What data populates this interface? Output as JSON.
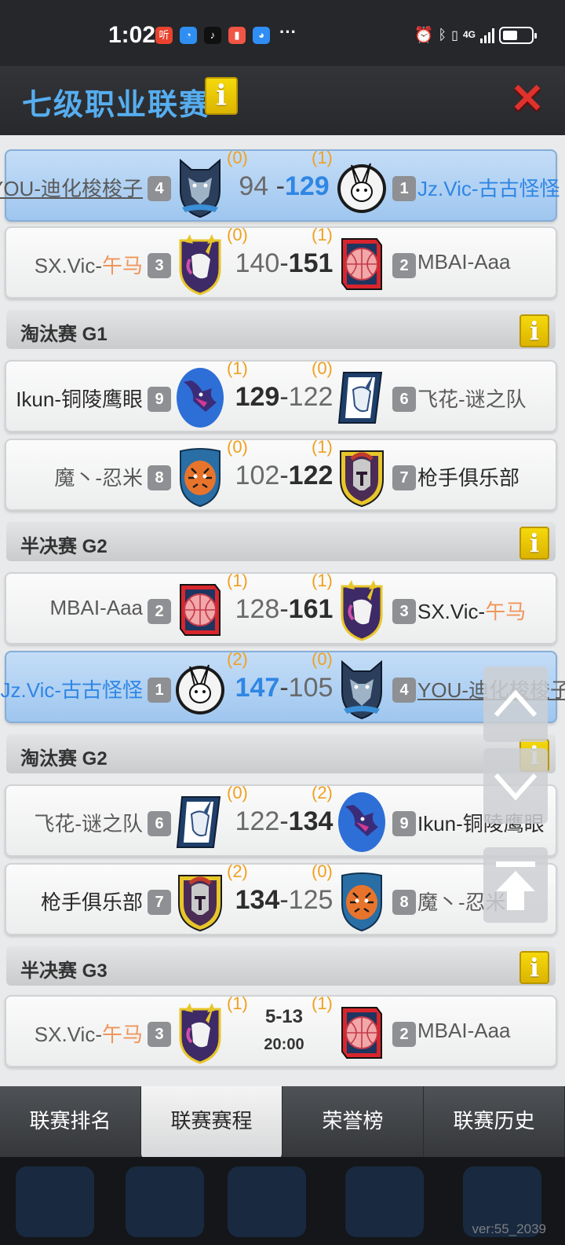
{
  "status_bar": {
    "time": "1:02",
    "network": "4G",
    "apps": [
      {
        "name": "listen-app-icon",
        "glyph": "听",
        "color": "#e8432f"
      },
      {
        "name": "chat-app-icon",
        "glyph": "◔",
        "color": "#2e8ef2"
      },
      {
        "name": "tiktok-icon",
        "glyph": "♪",
        "color": "#101010"
      },
      {
        "name": "red-app-icon",
        "glyph": "▮",
        "color": "#f05545"
      },
      {
        "name": "weibo-icon",
        "glyph": "◕",
        "color": "#2f8df4"
      }
    ],
    "more": "···"
  },
  "header": {
    "title": "七级职业联赛",
    "info_glyph": "i",
    "close_glyph": "✕"
  },
  "matches": [
    {
      "left": {
        "name": "YOU-迪化梭梭子",
        "seed": "4",
        "wins": "(0)",
        "logo": "wolf"
      },
      "right": {
        "name_a": "Jz.Vic-古古怪怪",
        "name_b": "",
        "seed": "1",
        "wins": "(1)",
        "logo": "rabbit"
      },
      "score_left": "94",
      "score_right": "129",
      "highlight": true,
      "winner": "right"
    },
    {
      "left": {
        "name_a": "SX.Vic-",
        "name_b": "午马",
        "seed": "3",
        "wins": "(0)",
        "logo": "unicorn"
      },
      "right": {
        "name_a": "MBAI-Aaa",
        "name_b": "",
        "seed": "2",
        "wins": "(1)",
        "logo": "basketball"
      },
      "score_left": "140",
      "score_right": "151",
      "highlight": false,
      "winner": "right"
    },
    {
      "left": {
        "name_a": "Ikun-铜陵鹰眼",
        "name_b": "",
        "seed": "9",
        "wins": "(1)",
        "logo": "dragon"
      },
      "right": {
        "name_a": "飞花-谜之队",
        "name_b": "",
        "seed": "6",
        "wins": "(0)",
        "logo": "unicorn-blue"
      },
      "score_left": "129",
      "score_right": "122",
      "highlight": false,
      "winner": "left"
    },
    {
      "left": {
        "name_a": "魔丶-忍米",
        "name_b": "",
        "seed": "8",
        "wins": "(0)",
        "logo": "tiger"
      },
      "right": {
        "name_a": "枪手俱乐部",
        "name_b": "",
        "seed": "7",
        "wins": "(1)",
        "logo": "spartan"
      },
      "score_left": "102",
      "score_right": "122",
      "highlight": false,
      "winner": "right"
    },
    {
      "left": {
        "name_a": "MBAI-Aaa",
        "name_b": "",
        "seed": "2",
        "wins": "(1)",
        "logo": "basketball"
      },
      "right": {
        "name_a": "SX.Vic-",
        "name_b": "午马",
        "seed": "3",
        "wins": "(1)",
        "logo": "unicorn"
      },
      "score_left": "128",
      "score_right": "161",
      "highlight": false,
      "winner": "right"
    },
    {
      "left": {
        "name_a": "Jz.Vic-古古怪怪",
        "name_b": "",
        "seed": "1",
        "wins": "(2)",
        "logo": "rabbit"
      },
      "right": {
        "name": "YOU-迪化梭梭子",
        "seed": "4",
        "wins": "(0)",
        "logo": "wolf"
      },
      "score_left": "147",
      "score_right": "105",
      "highlight": true,
      "winner": "left"
    },
    {
      "left": {
        "name_a": "飞花-谜之队",
        "name_b": "",
        "seed": "6",
        "wins": "(0)",
        "logo": "unicorn-blue"
      },
      "right": {
        "name_a": "Ikun-铜陵鹰眼",
        "name_b": "",
        "seed": "9",
        "wins": "(2)",
        "logo": "dragon"
      },
      "score_left": "122",
      "score_right": "134",
      "highlight": false,
      "winner": "right"
    },
    {
      "left": {
        "name_a": "枪手俱乐部",
        "name_b": "",
        "seed": "7",
        "wins": "(2)",
        "logo": "spartan"
      },
      "right": {
        "name_a": "魔丶-忍米",
        "name_b": "",
        "seed": "8",
        "wins": "(0)",
        "logo": "tiger"
      },
      "score_left": "134",
      "score_right": "125",
      "highlight": false,
      "winner": "left"
    },
    {
      "left": {
        "name_a": "SX.Vic-",
        "name_b": "午马",
        "seed": "3",
        "wins": "(1)",
        "logo": "unicorn"
      },
      "right": {
        "name_a": "MBAI-Aaa",
        "name_b": "",
        "seed": "2",
        "wins": "(1)",
        "logo": "basketball"
      },
      "date": "5-13",
      "time": "20:00",
      "highlight": false,
      "scheduled": true
    }
  ],
  "sections": [
    {
      "label": "淘汰赛 G1"
    },
    {
      "label": "半决赛 G2"
    },
    {
      "label": "淘汰赛 G2"
    },
    {
      "label": "半决赛 G3"
    }
  ],
  "tabs": [
    {
      "label": "联赛排名",
      "active": false
    },
    {
      "label": "联赛赛程",
      "active": true
    },
    {
      "label": "荣誉榜",
      "active": false
    },
    {
      "label": "联赛历史",
      "active": false
    }
  ],
  "version": "ver:55_2039",
  "colors": {
    "accent_blue": "#2f86e4",
    "title_blue": "#56aef0",
    "wins_orange": "#f0a020",
    "name_orange": "#f0955a",
    "close_red": "#e0322c",
    "info_yellow": "#f0d20a"
  }
}
